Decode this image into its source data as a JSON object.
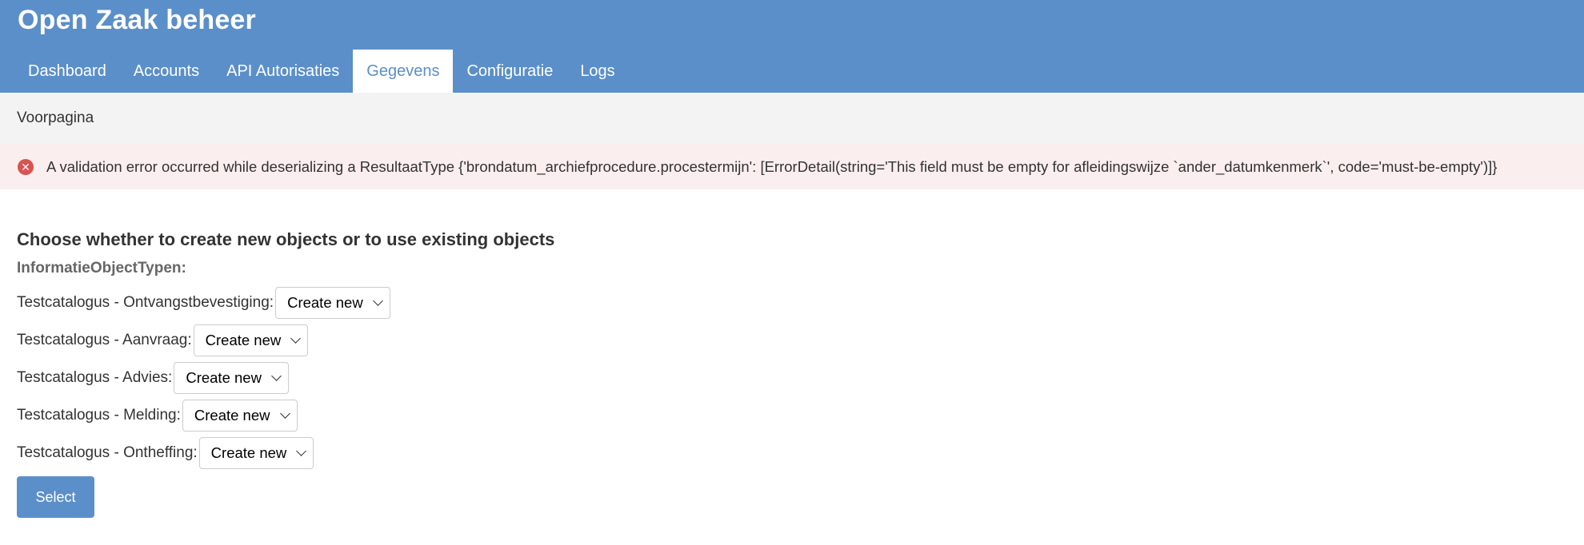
{
  "header": {
    "site_title": "Open Zaak beheer",
    "nav": [
      {
        "label": "Dashboard"
      },
      {
        "label": "Accounts"
      },
      {
        "label": "API Autorisaties"
      },
      {
        "label": "Gegevens",
        "active": true
      },
      {
        "label": "Configuratie"
      },
      {
        "label": "Logs"
      }
    ]
  },
  "breadcrumb": {
    "home": "Voorpagina"
  },
  "messages": {
    "error_icon": "error-circle-x-icon",
    "error_text": "A validation error occurred while deserializing a ResultaatType {'brondatum_archiefprocedure.procestermijn': [ErrorDetail(string='This field must be empty for afleidingswijze `ander_datumkenmerk`', code='must-be-empty')]}"
  },
  "form": {
    "title": "Choose whether to create new objects or to use existing objects",
    "group_label": "InformatieObjectTypen:",
    "rows": [
      {
        "label": "Testcatalogus - Ontvangstbevestiging:",
        "value": "Create new"
      },
      {
        "label": "Testcatalogus - Aanvraag:",
        "value": "Create new"
      },
      {
        "label": "Testcatalogus - Advies:",
        "value": "Create new"
      },
      {
        "label": "Testcatalogus - Melding:",
        "value": "Create new"
      },
      {
        "label": "Testcatalogus - Ontheffing:",
        "value": "Create new"
      }
    ],
    "submit_label": "Select"
  },
  "colors": {
    "header_bg": "#5b8fc9",
    "breadcrumb_bg": "#f3f3f3",
    "error_bg": "#fbeeee",
    "error_icon": "#d9534f"
  }
}
